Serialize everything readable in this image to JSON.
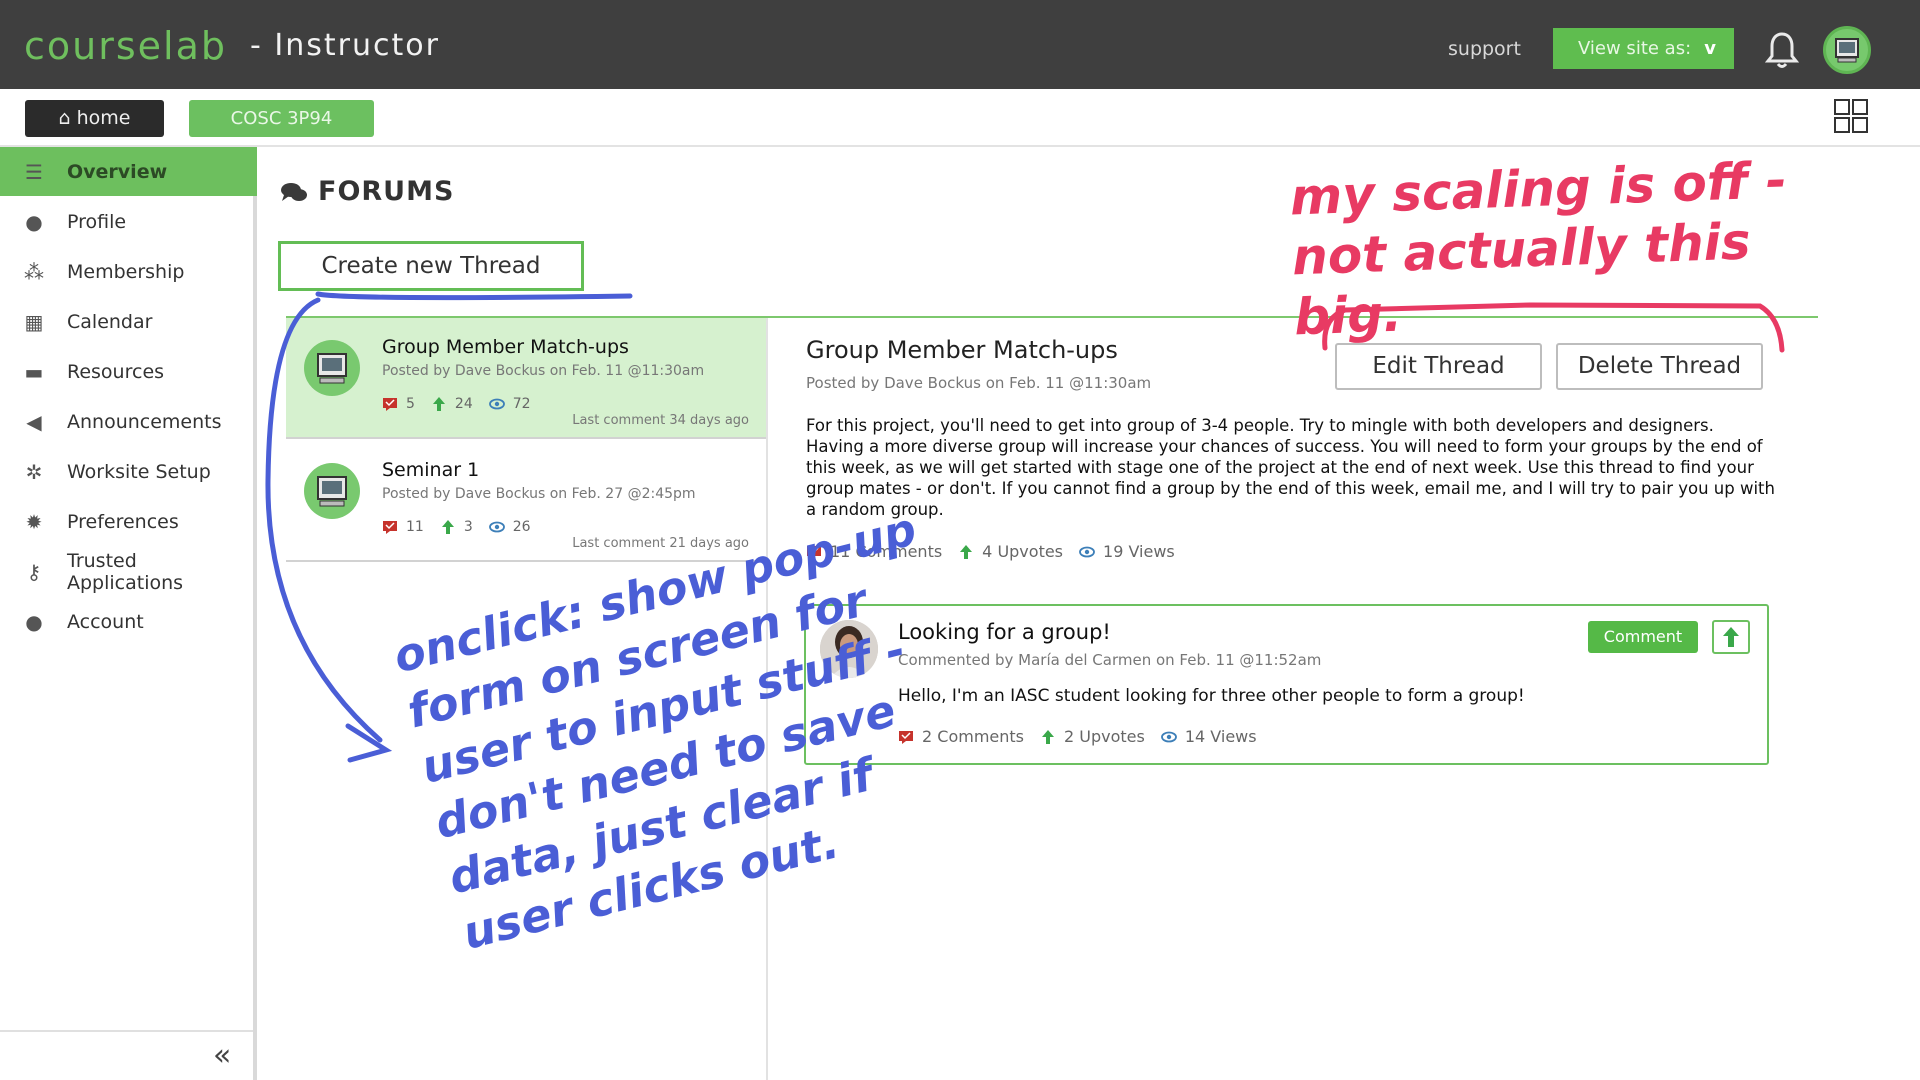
{
  "header": {
    "brand": "courselab",
    "role": "- Instructor",
    "support": "support",
    "view_site_label": "View site as:",
    "view_site_chevron": "v",
    "icons": [
      "bell-icon",
      "user-avatar-icon"
    ]
  },
  "subnav": {
    "home_label": "home",
    "course_label": "COSC 3P94",
    "icons": [
      "home-icon",
      "apps-grid-icon"
    ]
  },
  "sidebar": {
    "items": [
      {
        "label": "Overview",
        "icon": "list-icon",
        "active": true
      },
      {
        "label": "Profile",
        "icon": "user-icon"
      },
      {
        "label": "Membership",
        "icon": "users-icon"
      },
      {
        "label": "Calendar",
        "icon": "calendar-icon"
      },
      {
        "label": "Resources",
        "icon": "folder-icon"
      },
      {
        "label": "Announcements",
        "icon": "megaphone-icon"
      },
      {
        "label": "Worksite Setup",
        "icon": "cogs-icon"
      },
      {
        "label": "Preferences",
        "icon": "gear-icon"
      },
      {
        "label": "Trusted Applications",
        "icon": "key-icon"
      },
      {
        "label": "Account",
        "icon": "user-icon"
      }
    ],
    "collapse_label": "«"
  },
  "forums": {
    "title": "FORUMS",
    "create_label": "Create new Thread",
    "threads": [
      {
        "title": "Group Member Match-ups",
        "meta": "Posted by Dave Bockus on Feb. 11 @11:30am",
        "comments": "5",
        "upvotes": "24",
        "views": "72",
        "last": "Last comment 34 days ago",
        "selected": true
      },
      {
        "title": "Seminar 1",
        "meta": "Posted by Dave Bockus on Feb. 27 @2:45pm",
        "comments": "11",
        "upvotes": "3",
        "views": "26",
        "last": "Last comment 21 days ago",
        "selected": false
      }
    ]
  },
  "detail": {
    "title": "Group Member Match-ups",
    "meta": "Posted by Dave Bockus on Feb. 11 @11:30am",
    "edit_label": "Edit Thread",
    "delete_label": "Delete Thread",
    "body": "For this project, you'll need to get into group of 3-4 people. Try to mingle with both developers and designers. Having a more diverse group will increase your chances of success. You will need to form your groups by the end of this week, as we will get started with stage one of the project at the end of next week. Use this thread to find your group mates - or don't. If you cannot find a group by the end of this week, email me, and I will try to pair you up with a random group.",
    "comments": "11 Comments",
    "upvotes": "4 Upvotes",
    "views": "19 Views"
  },
  "comment": {
    "title": "Looking for a group!",
    "meta": "Commented by María del Carmen on Feb. 11 @11:52am",
    "body": "Hello, I'm an IASC student looking for three other people to form a group!",
    "comment_button": "Comment",
    "comments": "2 Comments",
    "upvotes": "2 Upvotes",
    "views": "14 Views"
  },
  "annotations": {
    "red": "my scaling is off - not actually this big.",
    "blue": "onclick: show pop-up form on screen for user to input stuff - don't need to save data, just clear if user clicks out."
  },
  "colors": {
    "brand_green": "#6fbf5e",
    "topbar": "#3f3f3f",
    "annotation_red": "#e83a63",
    "annotation_blue": "#4a5ed6"
  }
}
